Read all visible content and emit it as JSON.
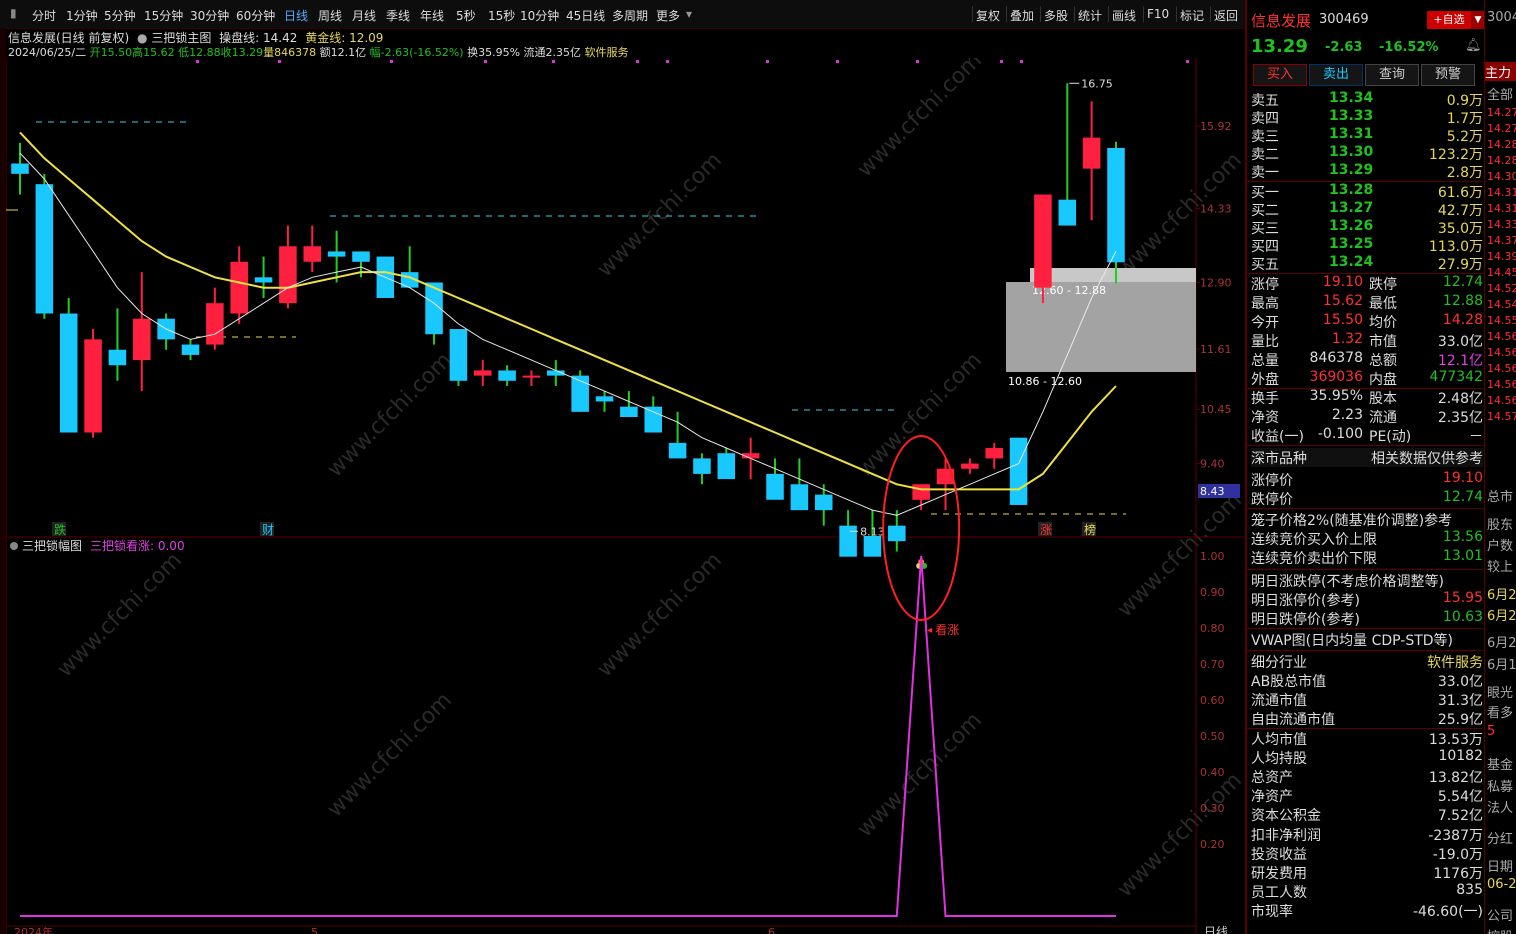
{
  "toolbar": {
    "periods": [
      "分时",
      "1分钟",
      "5分钟",
      "15分钟",
      "30分钟",
      "60分钟",
      "日线",
      "周线",
      "月线",
      "季线",
      "年线",
      "5秒",
      "15秒",
      "10分钟",
      "45日线",
      "多周期",
      "更多"
    ],
    "active_period": "日线",
    "right_buttons": [
      "复权",
      "叠加",
      "多股",
      "统计",
      "画线",
      "F10",
      "标记",
      "返回"
    ]
  },
  "info": {
    "title": "信息发展(日线 前复权)",
    "indicator": "三把锁主图",
    "op_line_label": "操盘线: 14.42",
    "gold_line_label": "黄金线: 12.09",
    "date": "2024/06/25/二",
    "open": "开15.50",
    "high": "高15.62",
    "low": "低12.88",
    "close": "收13.29",
    "volume": "量846378",
    "amount": "额12.1亿",
    "change": "幅-2.63(-16.52%)",
    "turnover": "换35.95%",
    "float": "流通2.35亿",
    "industry": "软件服务"
  },
  "chart": {
    "y_ticks": [
      "15.92",
      "14.33",
      "12.90",
      "11.61",
      "10.45",
      "9.40",
      "8.43"
    ],
    "current_price_tag": "8.43",
    "high_label": "16.75",
    "low_label": "8.13",
    "box_upper_label": "12.60 - 12.88",
    "box_lower_label": "10.86 - 12.60",
    "markers": [
      "跌",
      "财",
      "涨",
      "榜"
    ],
    "sub_title": "三把锁幅图",
    "sub_value": "三把锁看涨: 0.00",
    "sub_y_ticks": [
      "1.00",
      "0.90",
      "0.80",
      "0.70",
      "0.60",
      "0.50",
      "0.40",
      "0.30",
      "0.20"
    ],
    "signal_label": "看涨",
    "bottom_labels": [
      "2024年",
      "5",
      "6"
    ],
    "bottom_period": "日线",
    "watermark": "www.cfchi.com"
  },
  "chart_data": {
    "type": "candlestick",
    "ohlc": [
      [
        15.2,
        15.6,
        14.6,
        15.0
      ],
      [
        14.8,
        15.0,
        12.2,
        12.3
      ],
      [
        12.3,
        12.6,
        10.0,
        10.0
      ],
      [
        10.0,
        12.0,
        9.9,
        11.8
      ],
      [
        11.6,
        12.4,
        11.0,
        11.3
      ],
      [
        11.4,
        13.1,
        10.8,
        12.2
      ],
      [
        12.2,
        12.3,
        11.6,
        11.8
      ],
      [
        11.7,
        11.8,
        11.4,
        11.5
      ],
      [
        11.7,
        12.8,
        11.6,
        12.5
      ],
      [
        12.3,
        13.6,
        12.1,
        13.3
      ],
      [
        13.0,
        13.4,
        12.6,
        12.9
      ],
      [
        12.5,
        14.0,
        12.4,
        13.6
      ],
      [
        13.3,
        14.0,
        13.1,
        13.6
      ],
      [
        13.5,
        13.9,
        12.9,
        13.4
      ],
      [
        13.5,
        13.5,
        13.0,
        13.3
      ],
      [
        13.4,
        13.4,
        12.6,
        12.6
      ],
      [
        13.1,
        13.6,
        12.9,
        12.8
      ],
      [
        12.9,
        12.9,
        11.7,
        11.9
      ],
      [
        12.0,
        12.0,
        10.9,
        11.0
      ],
      [
        11.1,
        11.4,
        10.9,
        11.2
      ],
      [
        11.2,
        11.3,
        10.9,
        11.0
      ],
      [
        11.1,
        11.2,
        10.9,
        11.1
      ],
      [
        11.2,
        11.4,
        10.9,
        11.1
      ],
      [
        11.1,
        11.2,
        10.4,
        10.4
      ],
      [
        10.7,
        10.8,
        10.4,
        10.6
      ],
      [
        10.5,
        10.8,
        10.3,
        10.3
      ],
      [
        10.5,
        10.7,
        10.1,
        10.0
      ],
      [
        9.8,
        10.4,
        9.8,
        9.5
      ],
      [
        9.5,
        9.6,
        9.0,
        9.2
      ],
      [
        9.6,
        9.7,
        9.2,
        9.1
      ],
      [
        9.5,
        9.9,
        9.1,
        9.6
      ],
      [
        9.2,
        9.5,
        8.9,
        8.7
      ],
      [
        9.0,
        9.5,
        8.6,
        8.5
      ],
      [
        8.8,
        9.0,
        8.2,
        8.5
      ],
      [
        8.2,
        8.5,
        8.1,
        7.6
      ],
      [
        8.0,
        8.5,
        7.7,
        7.6
      ],
      [
        8.2,
        8.5,
        7.7,
        7.9
      ],
      [
        8.7,
        9.0,
        8.5,
        9.0
      ],
      [
        9.0,
        9.5,
        8.5,
        9.3
      ],
      [
        9.3,
        9.5,
        9.2,
        9.4
      ],
      [
        9.5,
        9.8,
        9.3,
        9.7
      ],
      [
        9.9,
        9.9,
        8.7,
        8.6
      ],
      [
        12.8,
        14.5,
        12.5,
        14.6
      ],
      [
        14.5,
        16.75,
        14.1,
        14.0
      ],
      [
        15.1,
        16.4,
        14.1,
        15.7
      ],
      [
        15.5,
        15.62,
        12.88,
        13.29
      ]
    ],
    "ma_white": [
      15.4,
      14.9,
      14.2,
      13.5,
      12.8,
      12.3,
      12.0,
      11.8,
      11.9,
      12.2,
      12.5,
      12.8,
      13.0,
      13.1,
      13.2,
      13.0,
      12.8,
      12.5,
      12.1,
      11.8,
      11.6,
      11.4,
      11.2,
      11.0,
      10.8,
      10.6,
      10.4,
      10.2,
      9.9,
      9.7,
      9.5,
      9.3,
      9.1,
      8.9,
      8.7,
      8.5,
      8.4,
      8.6,
      8.8,
      9.0,
      9.2,
      9.4,
      10.4,
      11.5,
      12.6,
      13.5
    ],
    "ma_yellow": [
      15.8,
      15.3,
      14.9,
      14.5,
      14.1,
      13.7,
      13.4,
      13.2,
      13.0,
      12.9,
      12.8,
      12.8,
      12.9,
      13.0,
      13.1,
      13.1,
      13.0,
      12.8,
      12.6,
      12.4,
      12.2,
      12.0,
      11.8,
      11.6,
      11.4,
      11.2,
      11.0,
      10.8,
      10.6,
      10.4,
      10.2,
      10.0,
      9.8,
      9.6,
      9.4,
      9.2,
      9.0,
      8.9,
      8.9,
      8.9,
      8.9,
      8.9,
      9.2,
      9.8,
      10.4,
      10.9
    ],
    "indicator_values": [
      0,
      0,
      0,
      0,
      0,
      0,
      0,
      0,
      0,
      0,
      0,
      0,
      0,
      0,
      0,
      0,
      0,
      0,
      0,
      0,
      0,
      0,
      0,
      0,
      0,
      0,
      0,
      0,
      0,
      0,
      0,
      0,
      0,
      0,
      0,
      0,
      0,
      1,
      0,
      0,
      0,
      0,
      0,
      0,
      0,
      0
    ],
    "ylim": [
      8.0,
      17.2
    ]
  },
  "quote": {
    "name": "信息发展",
    "code": "300469",
    "add_watch": "+自选",
    "price": "13.29",
    "change": "-2.63",
    "pct": "-16.52%",
    "buttons": [
      "买入",
      "卖出",
      "查询",
      "预警"
    ],
    "asks": [
      {
        "label": "卖五",
        "price": "13.34",
        "vol": "0.9万"
      },
      {
        "label": "卖四",
        "price": "13.33",
        "vol": "1.7万"
      },
      {
        "label": "卖三",
        "price": "13.31",
        "vol": "5.2万"
      },
      {
        "label": "卖二",
        "price": "13.30",
        "vol": "123.2万"
      },
      {
        "label": "卖一",
        "price": "13.29",
        "vol": "2.8万"
      }
    ],
    "bids": [
      {
        "label": "买一",
        "price": "13.28",
        "vol": "61.6万"
      },
      {
        "label": "买二",
        "price": "13.27",
        "vol": "42.7万"
      },
      {
        "label": "买三",
        "price": "13.26",
        "vol": "35.0万"
      },
      {
        "label": "买四",
        "price": "13.25",
        "vol": "113.0万"
      },
      {
        "label": "买五",
        "price": "13.24",
        "vol": "27.9万"
      }
    ],
    "stats": [
      {
        "l1": "涨停",
        "v1": "19.10",
        "c1": "red",
        "l2": "跌停",
        "v2": "12.74",
        "c2": "grn"
      },
      {
        "l1": "最高",
        "v1": "15.62",
        "c1": "red",
        "l2": "最低",
        "v2": "12.88",
        "c2": "grn"
      },
      {
        "l1": "今开",
        "v1": "15.50",
        "c1": "red",
        "l2": "均价",
        "v2": "14.28",
        "c2": "red"
      },
      {
        "l1": "量比",
        "v1": "1.32",
        "c1": "red",
        "l2": "市值",
        "v2": "33.0亿",
        "c2": "wht"
      },
      {
        "l1": "总量",
        "v1": "846378",
        "c1": "wht",
        "l2": "总额",
        "v2": "12.1亿",
        "c2": "mag"
      },
      {
        "l1": "外盘",
        "v1": "369036",
        "c1": "red",
        "l2": "内盘",
        "v2": "477342",
        "c2": "grn"
      },
      {
        "l1": "换手",
        "v1": "35.95%",
        "c1": "wht",
        "l2": "股本",
        "v2": "2.48亿",
        "c2": "wht"
      },
      {
        "l1": "净资",
        "v1": "2.23",
        "c1": "wht",
        "l2": "流通",
        "v2": "2.35亿",
        "c2": "wht"
      },
      {
        "l1": "收益(一)",
        "v1": "-0.100",
        "c1": "wht",
        "l2": "PE(动)",
        "v2": "－",
        "c2": "wht"
      }
    ],
    "deep_header": "深市品种",
    "deep_header_right": "相关数据仅供参考",
    "limit_rows": [
      {
        "l": "涨停价",
        "v": "19.10",
        "c": "red"
      },
      {
        "l": "跌停价",
        "v": "12.74",
        "c": "grn"
      }
    ],
    "cage_title": "笼子价格2%(随基准价调整)参考",
    "cage_rows": [
      {
        "l": "连续竞价买入价上限",
        "v": "13.56",
        "c": "grn"
      },
      {
        "l": "连续竞价卖出价下限",
        "v": "13.01",
        "c": "grn"
      }
    ],
    "tomorrow_title": "明日涨跌停(不考虑价格调整等)",
    "tomorrow_rows": [
      {
        "l": "明日涨停价(参考)",
        "v": "15.95",
        "c": "red"
      },
      {
        "l": "明日跌停价(参考)",
        "v": "10.63",
        "c": "grn"
      }
    ],
    "vwap_title": "VWAP图(日内均量 CDP-STD等)",
    "industry_row": {
      "l": "细分行业",
      "v": "软件服务"
    },
    "fund_rows": [
      {
        "l": "AB股总市值",
        "v": "33.0亿"
      },
      {
        "l": "流通市值",
        "v": "31.3亿"
      },
      {
        "l": "自由流通市值",
        "v": "25.9亿"
      },
      {
        "l": "人均市值",
        "v": "13.53万"
      },
      {
        "l": "人均持股",
        "v": "10182"
      },
      {
        "l": "总资产",
        "v": "13.82亿"
      },
      {
        "l": "净资产",
        "v": "5.54亿"
      },
      {
        "l": "资本公积金",
        "v": "7.52亿"
      },
      {
        "l": "扣非净利润",
        "v": "-2387万"
      },
      {
        "l": "投资收益",
        "v": "-19.0万"
      },
      {
        "l": "研发费用",
        "v": "1176万"
      },
      {
        "l": "员工人数",
        "v": "835"
      },
      {
        "l": "市现率",
        "v": "-46.60(一)"
      }
    ]
  },
  "far_panel": {
    "items": [
      "3004",
      "主力",
      "全部",
      "14.27",
      "14.27",
      "14.28",
      "14.28",
      "14.30",
      "14.31",
      "14.31",
      "14.33",
      "14.37",
      "14.39",
      "14.45",
      "14.52",
      "14.54",
      "14.55",
      "14.56",
      "14.56",
      "14.56",
      "14.56",
      "14.56",
      "14.57",
      "总市",
      "股东",
      "户数",
      "较上",
      "6月2",
      "6月2",
      "6月2",
      "6月1",
      "眼光",
      "看多",
      "5",
      "基金",
      "私募",
      "法人",
      "分红",
      "日期",
      "06-2",
      "公司",
      "控股"
    ]
  },
  "colors": {
    "up": "#ff2040",
    "down": "#18c8ff",
    "ma_white": "#e8e8e8",
    "ma_yellow": "#f0e040",
    "indicator": "#e030e0",
    "grid": "#5a0000",
    "ellipse": "#ff2020"
  }
}
